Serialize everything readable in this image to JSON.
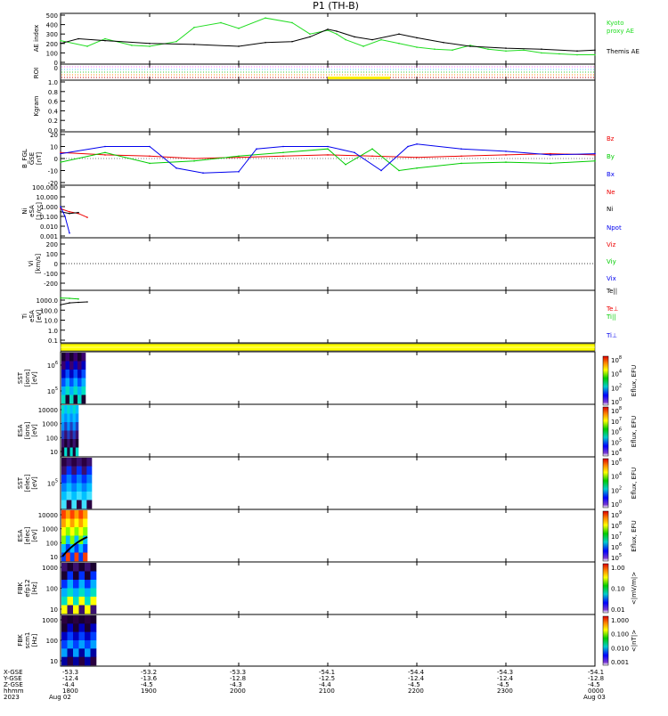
{
  "title": "P1 (TH-B)",
  "colors": {
    "kyoto": "#22dd22",
    "themis": "#000000",
    "red": "#ee0000",
    "green": "#00cc00",
    "blue": "#0000ee",
    "flag": "#ffff00"
  },
  "chart_data": [
    {
      "type": "line",
      "panel": "ae",
      "ylabel": "AE index",
      "yticks": [
        "500",
        "400",
        "300",
        "200",
        "100",
        "0"
      ],
      "ylim": [
        0,
        500
      ],
      "series": [
        {
          "name": "Kyoto proxy AE",
          "label_lines": [
            "Kyoto",
            "proxy AE"
          ],
          "color": "kyoto",
          "x": [
            18.0,
            18.3,
            18.5,
            18.8,
            19.0,
            19.3,
            19.5,
            19.8,
            20.0,
            20.3,
            20.6,
            20.8,
            21.0,
            21.1,
            21.2,
            21.4,
            21.6,
            21.8,
            22.0,
            22.2,
            22.4,
            22.6,
            22.8,
            23.0,
            23.2,
            23.4,
            23.6,
            23.8,
            24.0
          ],
          "values": [
            230,
            170,
            250,
            180,
            170,
            220,
            370,
            420,
            360,
            470,
            420,
            300,
            340,
            300,
            240,
            170,
            240,
            200,
            160,
            140,
            130,
            180,
            140,
            120,
            130,
            100,
            90,
            80,
            80
          ]
        },
        {
          "name": "Themis AE",
          "label_lines": [
            "Themis AE"
          ],
          "color": "themis",
          "x": [
            18.0,
            18.2,
            18.5,
            19.0,
            19.5,
            20.0,
            20.3,
            20.6,
            20.8,
            21.0,
            21.1,
            21.3,
            21.5,
            21.8,
            22.0,
            22.3,
            22.6,
            23.0,
            23.4,
            23.8,
            24.0
          ],
          "values": [
            200,
            250,
            230,
            200,
            190,
            170,
            210,
            220,
            270,
            350,
            330,
            270,
            240,
            300,
            260,
            210,
            170,
            150,
            140,
            120,
            130
          ]
        }
      ]
    },
    {
      "type": "line",
      "panel": "roi",
      "ylabel": "ROI",
      "ytick_top": "0"
    },
    {
      "type": "line",
      "panel": "kgm",
      "ylabel": "Kgram",
      "yticks": [
        "1.0",
        "0.8",
        "0.6",
        "0.4",
        "0.2",
        "0.0"
      ]
    },
    {
      "type": "line",
      "panel": "bfgl",
      "ylabel_lines": [
        "B_FGL",
        "GSE",
        "[nT]"
      ],
      "yticks": [
        "20",
        "10",
        "0",
        "-10",
        "-20"
      ],
      "ylim": [
        -20,
        20
      ],
      "series": [
        {
          "name": "Bz",
          "color": "red",
          "x": [
            18.0,
            18.5,
            19.0,
            19.5,
            20.0,
            20.5,
            21.0,
            21.5,
            22.0,
            22.5,
            23.0,
            23.5,
            24.0
          ],
          "values": [
            5,
            3,
            2,
            0,
            1,
            2,
            3,
            2,
            1,
            2,
            3,
            4,
            3
          ]
        },
        {
          "name": "By",
          "color": "green",
          "x": [
            18.0,
            18.5,
            19.0,
            19.5,
            20.0,
            20.5,
            21.0,
            21.2,
            21.5,
            21.8,
            22.0,
            22.5,
            23.0,
            23.5,
            24.0
          ],
          "values": [
            -3,
            5,
            -4,
            -2,
            2,
            5,
            8,
            -5,
            8,
            -10,
            -8,
            -4,
            -3,
            -4,
            -2
          ]
        },
        {
          "name": "Bx",
          "color": "blue",
          "x": [
            18.0,
            18.5,
            19.0,
            19.3,
            19.6,
            20.0,
            20.2,
            20.5,
            21.0,
            21.3,
            21.6,
            21.9,
            22.0,
            22.5,
            23.0,
            23.5,
            24.0
          ],
          "values": [
            4,
            10,
            10,
            -8,
            -12,
            -11,
            8,
            10,
            10,
            5,
            -10,
            10,
            12,
            8,
            6,
            3,
            4
          ]
        }
      ]
    },
    {
      "type": "line",
      "panel": "ni",
      "ylabel_lines": [
        "Ni",
        "eSA",
        "[1/cc]"
      ],
      "yticks": [
        "100.000",
        "10.000",
        "1.000",
        "0.100",
        "0.010",
        "0.001"
      ],
      "yscale": "log",
      "series": [
        {
          "name": "Ne",
          "color": "red",
          "x": [
            18.0,
            18.1,
            18.2,
            18.3
          ],
          "values": [
            0.6,
            0.3,
            0.2,
            0.08
          ]
        },
        {
          "name": "Ni",
          "color": "themis",
          "x": [
            18.0,
            18.1,
            18.2
          ],
          "values": [
            0.3,
            0.2,
            0.25
          ]
        },
        {
          "name": "Npot",
          "color": "blue",
          "x": [
            18.0,
            18.05,
            18.1
          ],
          "values": [
            1.0,
            0.1,
            0.002
          ]
        }
      ]
    },
    {
      "type": "line",
      "panel": "vi",
      "ylabel_lines": [
        "Vi",
        "[km/s]"
      ],
      "yticks": [
        "200",
        "100",
        "0",
        "-100",
        "-200"
      ],
      "ylim": [
        -300,
        300
      ],
      "series": [
        {
          "name": "Viz",
          "color": "red"
        },
        {
          "name": "Viy",
          "color": "green"
        },
        {
          "name": "Vix",
          "color": "blue"
        }
      ]
    },
    {
      "type": "line",
      "panel": "ti",
      "ylabel_lines": [
        "Ti",
        "eSA",
        "[eV]"
      ],
      "yticks": [
        "1000.0",
        "100.0",
        "10.0",
        "1.0",
        "0.1"
      ],
      "yscale": "log",
      "series": [
        {
          "name": "Te||",
          "label_html": "Te||",
          "color": "themis",
          "x": [
            18.0,
            18.1,
            18.2,
            18.3
          ],
          "values": [
            500,
            800,
            900,
            1000
          ]
        },
        {
          "name": "Te⊥",
          "color": "red"
        },
        {
          "name": "Ti||",
          "color": "green",
          "x": [
            18.0,
            18.1,
            18.2
          ],
          "values": [
            2500,
            2300,
            2000
          ]
        },
        {
          "name": "Ti⊥",
          "color": "blue"
        }
      ]
    },
    {
      "type": "heatmap",
      "panel": "sst_i",
      "ylabel_lines": [
        "SST",
        "[ions]",
        "[eV]"
      ],
      "yticks": [
        {
          "base": "10",
          "exp": "6"
        },
        {
          "base": "10",
          "exp": "5"
        }
      ],
      "colorbar_label": "Eflux, EFU",
      "colorbar_ticks": [
        {
          "base": "10",
          "exp": "8"
        },
        {
          "base": "10",
          "exp": "4"
        },
        {
          "base": "10",
          "exp": "2"
        },
        {
          "base": "10",
          "exp": "0"
        }
      ]
    },
    {
      "type": "heatmap",
      "panel": "esa_i",
      "ylabel_lines": [
        "ESA",
        "[ions]",
        "[eV]"
      ],
      "yticks": [
        "10000",
        "1000",
        "100",
        "10"
      ],
      "colorbar_label": "Eflux, EFU",
      "colorbar_ticks": [
        {
          "base": "10",
          "exp": "8"
        },
        {
          "base": "10",
          "exp": "7"
        },
        {
          "base": "10",
          "exp": "6"
        },
        {
          "base": "10",
          "exp": "5"
        },
        {
          "base": "10",
          "exp": "4"
        }
      ]
    },
    {
      "type": "heatmap",
      "panel": "sst_e",
      "ylabel_lines": [
        "SST",
        "[elec]",
        "[eV]"
      ],
      "yticks": [
        {
          "base": "10",
          "exp": "5"
        }
      ],
      "colorbar_label": "Eflux, EFU",
      "colorbar_ticks": [
        {
          "base": "10",
          "exp": "6"
        },
        {
          "base": "10",
          "exp": "4"
        },
        {
          "base": "10",
          "exp": "2"
        },
        {
          "base": "10",
          "exp": "0"
        }
      ]
    },
    {
      "type": "heatmap",
      "panel": "esa_e",
      "ylabel_lines": [
        "ESA",
        "[elec]",
        "[eV]"
      ],
      "yticks": [
        "10000",
        "1000",
        "100",
        "10"
      ],
      "colorbar_label": "Eflux, EFU",
      "colorbar_ticks": [
        {
          "base": "10",
          "exp": "9"
        },
        {
          "base": "10",
          "exp": "8"
        },
        {
          "base": "10",
          "exp": "7"
        },
        {
          "base": "10",
          "exp": "6"
        },
        {
          "base": "10",
          "exp": "5"
        }
      ]
    },
    {
      "type": "heatmap",
      "panel": "fbk_e",
      "ylabel_lines": [
        "FBK",
        "efp12",
        "[Hz]"
      ],
      "yticks": [
        "1000",
        "100",
        "10"
      ],
      "colorbar_label": "<|mV/m|>",
      "colorbar_ticks": [
        "1.00",
        "0.10",
        "0.01"
      ]
    },
    {
      "type": "heatmap",
      "panel": "fbk_b",
      "ylabel_lines": [
        "FBK",
        "scm1",
        "[Hz]"
      ],
      "yticks": [
        "1000",
        "100",
        "10"
      ],
      "colorbar_label": "<|nT|>",
      "colorbar_ticks": [
        "1.000",
        "0.100",
        "0.010",
        "0.001"
      ]
    }
  ],
  "xaxis": {
    "row_labels": [
      "X-GSE",
      "Y-GSE",
      "Z-GSE",
      "hhmm",
      "2023"
    ],
    "date_left": "Aug 02",
    "date_right": "Aug 03",
    "ticks": [
      {
        "hhmm": "1800",
        "x": "-53.3",
        "y": "-12.4",
        "z": "-4.4"
      },
      {
        "hhmm": "1900",
        "x": "-53.2",
        "y": "-13.6",
        "z": "-4.5"
      },
      {
        "hhmm": "2000",
        "x": "-53.3",
        "y": "-12.8",
        "z": "-4.3"
      },
      {
        "hhmm": "2100",
        "x": "-54.1",
        "y": "-12.5",
        "z": "-4.4"
      },
      {
        "hhmm": "2200",
        "x": "-54.4",
        "y": "-12.4",
        "z": "-4.5"
      },
      {
        "hhmm": "2300",
        "x": "-54.3",
        "y": "-12.4",
        "z": "-4.5"
      },
      {
        "hhmm": "0000",
        "x": "-54.1",
        "y": "-12.8",
        "z": "-4.5"
      }
    ]
  }
}
